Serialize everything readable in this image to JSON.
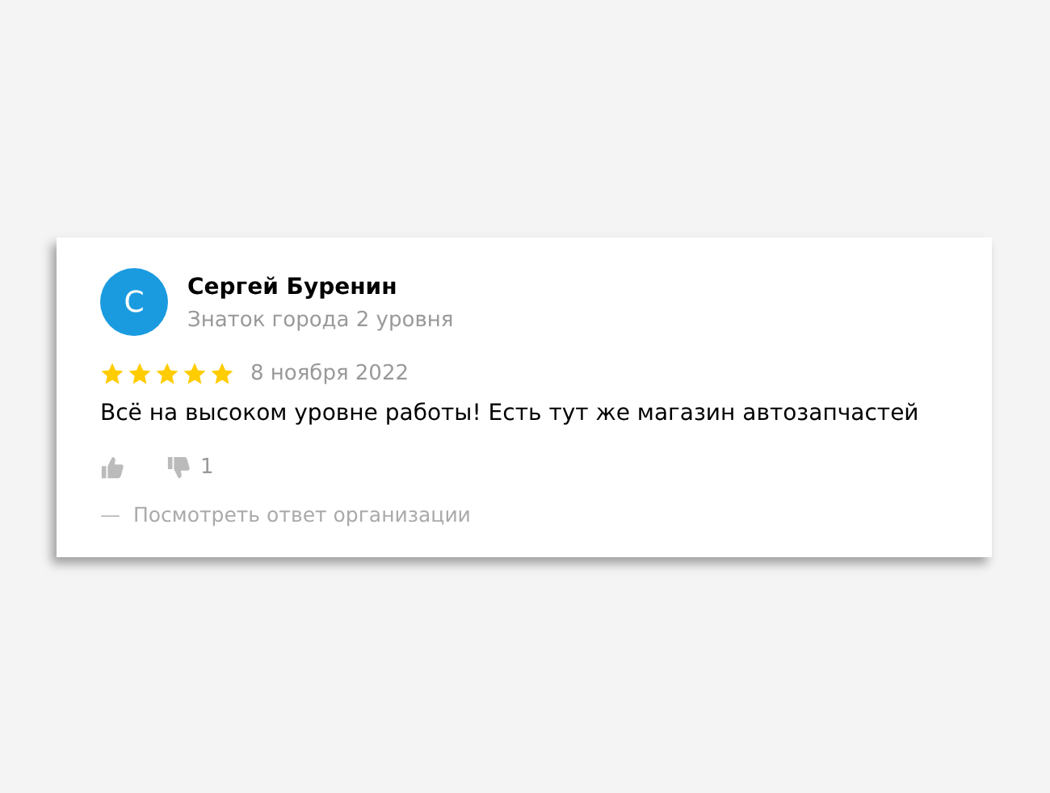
{
  "review": {
    "avatar_letter": "С",
    "author": "Сергей Буренин",
    "author_level": "Знаток города 2 уровня",
    "stars": 5,
    "date": "8 ноября 2022",
    "text": "Всё на высоком уровне работы! Есть тут же магазин автозапчастей",
    "likes": {
      "down_count": "1"
    },
    "reply_prefix": "—",
    "reply_link": "Посмотреть ответ организации"
  }
}
